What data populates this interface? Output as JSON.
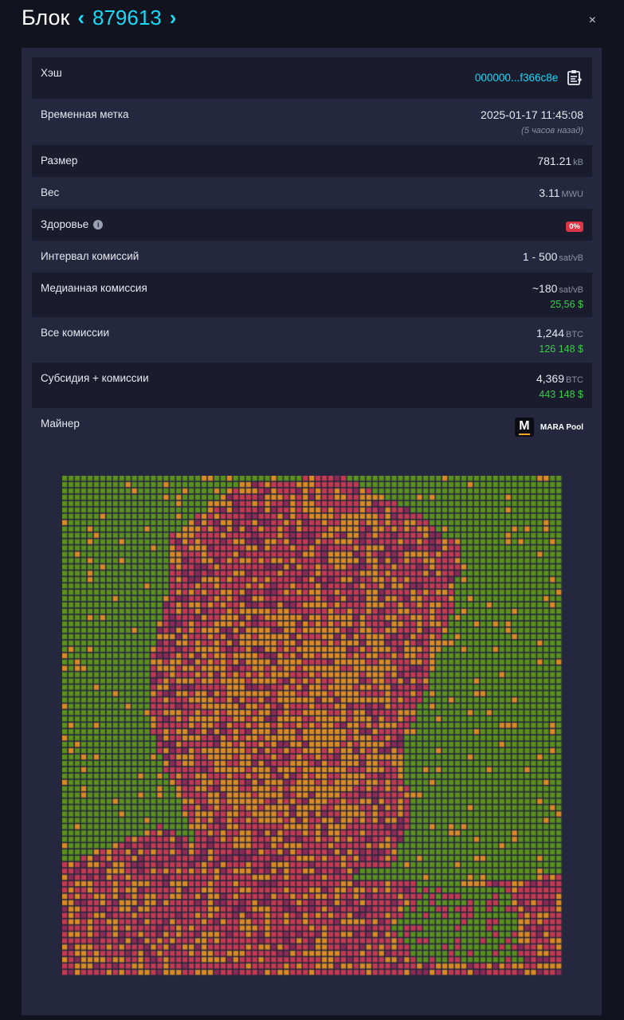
{
  "header": {
    "title": "Блок",
    "prev": "‹",
    "height": "879613",
    "next": "›",
    "close": "×"
  },
  "rows": {
    "hash": {
      "label": "Хэш",
      "value": "000000...f366c8e"
    },
    "timestamp": {
      "label": "Временная метка",
      "value": "2025-01-17 11:45:08",
      "ago": "(5 часов назад)"
    },
    "size": {
      "label": "Размер",
      "value": "781.21",
      "unit": "kB"
    },
    "weight": {
      "label": "Вес",
      "value": "3.11",
      "unit": "MWU"
    },
    "health": {
      "label": "Здоровье",
      "info": "i",
      "value": "0%"
    },
    "fee_span": {
      "label": "Интервал комиссий",
      "value": "1 - 500",
      "unit": "sat/vB"
    },
    "median_fee": {
      "label": "Медианная комиссия",
      "value": "~180",
      "unit": "sat/vB",
      "usd": "25,56 $"
    },
    "total_fees": {
      "label": "Все комиссии",
      "value": "1,244",
      "unit": "BTC",
      "usd": "126 148 $"
    },
    "subsidy_fees": {
      "label": "Субсидия + комиссии",
      "value": "4,369",
      "unit": "BTC",
      "usd": "443 148 $"
    },
    "miner": {
      "label": "Майнер",
      "logo_letter": "M",
      "name": "MARA Pool"
    }
  },
  "colors": {
    "accent": "#1bd8f4",
    "usd": "#3bcc49",
    "badge": "#dc3545",
    "tx_green": "#5b8f1e",
    "tx_orange": "#d98a25",
    "tx_red": "#c23a52",
    "tx_dark_red": "#8a2a55"
  }
}
